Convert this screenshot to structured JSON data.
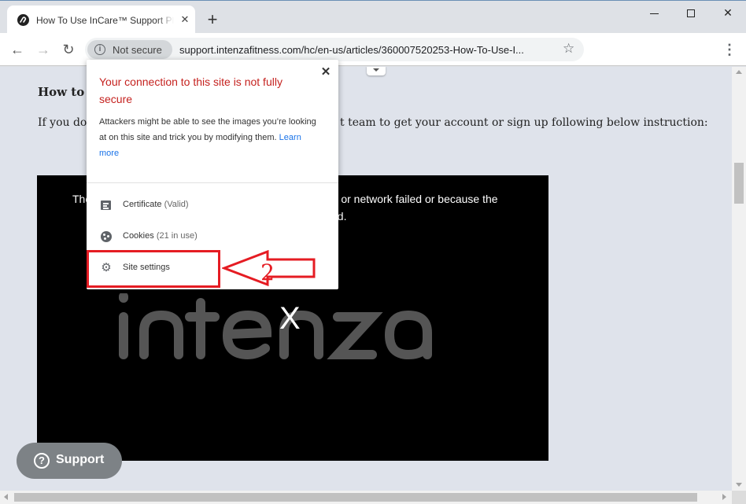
{
  "browser": {
    "tab_title": "How To Use InCare™ Support Pla",
    "tab_close_glyph": "✕",
    "new_tab_glyph": "+",
    "window_close_glyph": "✕",
    "back_glyph": "←",
    "forward_glyph": "→",
    "reload_glyph": "↻",
    "info_glyph": "i",
    "security_label": "Not secure",
    "url": "support.intenzafitness.com/hc/en-us/articles/360007520253-How-To-Use-I...",
    "star_glyph": "☆",
    "menu_glyph": "⋮"
  },
  "page": {
    "heading": "How to S",
    "line_a": "If you dor",
    "line_b": "t team to get your account or sign up following below instruction:",
    "video": {
      "msg_a": "The",
      "msg_b": "ver or network failed or because the",
      "msg_c": "ed.",
      "close_glyph": "X",
      "logo_text": "intenza"
    },
    "support_q_glyph": "?",
    "support_label": "Support"
  },
  "popup": {
    "title": "Your connection to this site is not fully secure",
    "close_glyph": "✕",
    "body": "Attackers might be able to see the images you’re looking at on this site and trick you by modifying them.",
    "learn_more": "Learn more",
    "rows": [
      {
        "label": "Certificate",
        "sub": "(Valid)"
      },
      {
        "label": "Cookies",
        "sub": "(21 in use)"
      },
      {
        "label": "Site settings",
        "sub": ""
      }
    ],
    "settings_glyph": "⚙"
  },
  "annotation": {
    "number": "2",
    "color": "#e51c23"
  },
  "icons": {
    "favicon": "intenza-logo-icon",
    "info": "info-icon",
    "star": "star-icon",
    "menu": "kebab-menu-icon",
    "certificate": "certificate-icon",
    "cookies": "cookie-icon",
    "settings": "gear-icon"
  }
}
